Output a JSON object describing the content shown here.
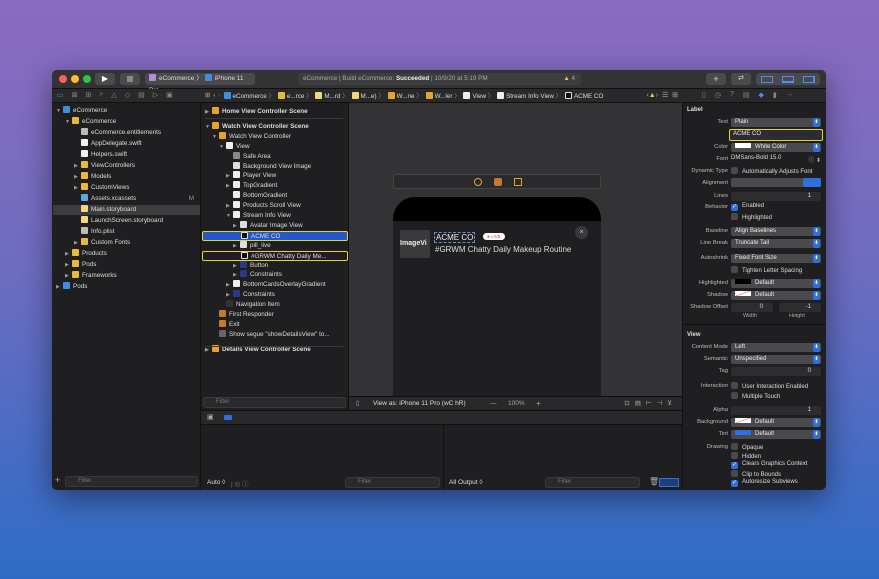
{
  "toolbar": {
    "scheme": "eCommerce",
    "device": "iPhone 11 Pro",
    "status_prefix": "eCommerce | Build eCommerce: ",
    "status_result": "Succeeded",
    "status_time": " | 10/9/20 at 5:19 PM",
    "warnings": "4"
  },
  "breadcrumb": [
    "eCommerce",
    "e...rce",
    "M...rd",
    "M...e)",
    "W...ne",
    "W...ler",
    "View",
    "Stream Info View",
    "ACME CO"
  ],
  "navigator": {
    "items": [
      {
        "label": "eCommerce",
        "depth": 0,
        "tri": "▼",
        "icon": "project"
      },
      {
        "label": "eCommerce",
        "depth": 1,
        "tri": "▼",
        "icon": "folder"
      },
      {
        "label": "eCommerce.entitlements",
        "depth": 2,
        "tri": "",
        "icon": "file"
      },
      {
        "label": "AppDelegate.swift",
        "depth": 2,
        "tri": "",
        "icon": "swift"
      },
      {
        "label": "Helpers.swift",
        "depth": 2,
        "tri": "",
        "icon": "swift"
      },
      {
        "label": "ViewControllers",
        "depth": 2,
        "tri": "▶",
        "icon": "folder"
      },
      {
        "label": "Models",
        "depth": 2,
        "tri": "▶",
        "icon": "folder"
      },
      {
        "label": "CustomViews",
        "depth": 2,
        "tri": "▶",
        "icon": "folder"
      },
      {
        "label": "Assets.xcassets",
        "depth": 2,
        "tri": "",
        "icon": "assets",
        "badge": "M"
      },
      {
        "label": "Main.storyboard",
        "depth": 2,
        "tri": "",
        "icon": "storyboard",
        "selected": true
      },
      {
        "label": "LaunchScreen.storyboard",
        "depth": 2,
        "tri": "",
        "icon": "storyboard"
      },
      {
        "label": "Info.plist",
        "depth": 2,
        "tri": "",
        "icon": "file"
      },
      {
        "label": "Custom Fonts",
        "depth": 2,
        "tri": "▶",
        "icon": "folder"
      },
      {
        "label": "Products",
        "depth": 1,
        "tri": "▶",
        "icon": "folder"
      },
      {
        "label": "Pods",
        "depth": 1,
        "tri": "▶",
        "icon": "folder"
      },
      {
        "label": "Frameworks",
        "depth": 1,
        "tri": "▶",
        "icon": "folder"
      },
      {
        "label": "Pods",
        "depth": 0,
        "tri": "▶",
        "icon": "project"
      }
    ],
    "filter_placeholder": "Filter"
  },
  "outline": {
    "items": [
      {
        "label": "Home View Controller Scene",
        "depth": 0,
        "tri": "▶",
        "icon": "scene",
        "bold": true
      },
      {
        "label": "Watch View Controller Scene",
        "depth": 0,
        "tri": "▼",
        "icon": "scene",
        "bold": true
      },
      {
        "label": "Watch View Controller",
        "depth": 1,
        "tri": "▼",
        "icon": "vc"
      },
      {
        "label": "View",
        "depth": 2,
        "tri": "▼",
        "icon": "view"
      },
      {
        "label": "Safe Area",
        "depth": 3,
        "tri": "",
        "icon": "safe"
      },
      {
        "label": "Background View Image",
        "depth": 3,
        "tri": "",
        "icon": "image"
      },
      {
        "label": "Player View",
        "depth": 3,
        "tri": "▶",
        "icon": "view"
      },
      {
        "label": "TopGradient",
        "depth": 3,
        "tri": "▶",
        "icon": "view"
      },
      {
        "label": "BottomGradient",
        "depth": 3,
        "tri": "",
        "icon": "view"
      },
      {
        "label": "Products Scroll View",
        "depth": 3,
        "tri": "▶",
        "icon": "view"
      },
      {
        "label": "Stream Info View",
        "depth": 3,
        "tri": "▼",
        "icon": "view"
      },
      {
        "label": "Avatar Image View",
        "depth": 4,
        "tri": "▶",
        "icon": "image"
      },
      {
        "label": "ACME CO",
        "depth": 4,
        "tri": "",
        "icon": "label",
        "selected": true
      },
      {
        "label": "pill_live",
        "depth": 4,
        "tri": "▶",
        "icon": "image"
      },
      {
        "label": "#GRWM Chatty Daily Me...",
        "depth": 4,
        "tri": "",
        "icon": "label",
        "highlight": true
      },
      {
        "label": "Button",
        "depth": 4,
        "tri": "▶",
        "icon": "button"
      },
      {
        "label": "Constraints",
        "depth": 4,
        "tri": "▶",
        "icon": "constraints"
      },
      {
        "label": "BottomCardsOverlayGradient",
        "depth": 3,
        "tri": "▶",
        "icon": "view"
      },
      {
        "label": "Constraints",
        "depth": 3,
        "tri": "▶",
        "icon": "constraints"
      },
      {
        "label": "Navigation Item",
        "depth": 2,
        "tri": "",
        "icon": "navitem"
      },
      {
        "label": "First Responder",
        "depth": 1,
        "tri": "",
        "icon": "responder"
      },
      {
        "label": "Exit",
        "depth": 1,
        "tri": "",
        "icon": "exit"
      },
      {
        "label": "Show segue \"showDetailsView\" to...",
        "depth": 1,
        "tri": "",
        "icon": "segue"
      },
      {
        "label": "Details View Controller Scene",
        "depth": 0,
        "tri": "▶",
        "icon": "scene",
        "bold": true
      }
    ],
    "filter_placeholder": "Filter"
  },
  "canvas": {
    "image_view": "ImageVi",
    "title": "ACME CO",
    "live": "LIVE",
    "subtitle": "#GRWM Chatty Daily Makeup Routine",
    "view_as": "View as: iPhone 11 Pro (wC hR)",
    "zoom": "100%"
  },
  "debug": {
    "auto": "Auto ◊",
    "output": "All Output ◊",
    "filter_placeholder": "Filter"
  },
  "inspector": {
    "section_label": "Label",
    "text_label": "Text",
    "text_type": "Plain",
    "text_value": "ACME CO",
    "color_label": "Color",
    "color_value": "White Color",
    "font_label": "Font",
    "font_value": "DMSans-Bold 15.0",
    "dynamic_label": "Dynamic Type",
    "dynamic_value": "Automatically Adjusts Font",
    "alignment_label": "Alignment",
    "lines_label": "Lines",
    "lines_value": "1",
    "behavior_label": "Behavior",
    "enabled": "Enabled",
    "highlighted": "Highlighted",
    "baseline_label": "Baseline",
    "baseline_value": "Align Baselines",
    "linebreak_label": "Line Break",
    "linebreak_value": "Truncate Tail",
    "autoshrink_label": "Autoshrink",
    "autoshrink_value": "Fixed Font Size",
    "tighten": "Tighten Letter Spacing",
    "hl_label": "Highlighted",
    "hl_value": "Default",
    "shadow_label": "Shadow",
    "shadow_value": "Default",
    "shadow_offset_label": "Shadow Offset",
    "shadow_w": "0",
    "shadow_h": "-1",
    "width": "Width",
    "height": "Height",
    "section_view": "View",
    "content_mode_label": "Content Mode",
    "content_mode": "Left",
    "semantic_label": "Semantic",
    "semantic": "Unspecified",
    "tag_label": "Tag",
    "tag": "0",
    "interaction_label": "Interaction",
    "user_interaction": "User Interaction Enabled",
    "multiple_touch": "Multiple Touch",
    "alpha_label": "Alpha",
    "alpha": "1",
    "background_label": "Background",
    "background": "Default",
    "tint_label": "Tint",
    "tint": "Default",
    "drawing_label": "Drawing",
    "opaque": "Opaque",
    "hidden": "Hidden",
    "clears": "Clears Graphics Context",
    "clip": "Clip to Bounds",
    "autoresize": "Autoresize Subviews"
  },
  "colors": {
    "accent": "#2f6fe0",
    "highlight": "#e8d32a",
    "selection": "#2458c8",
    "warning": "#f5c242"
  }
}
